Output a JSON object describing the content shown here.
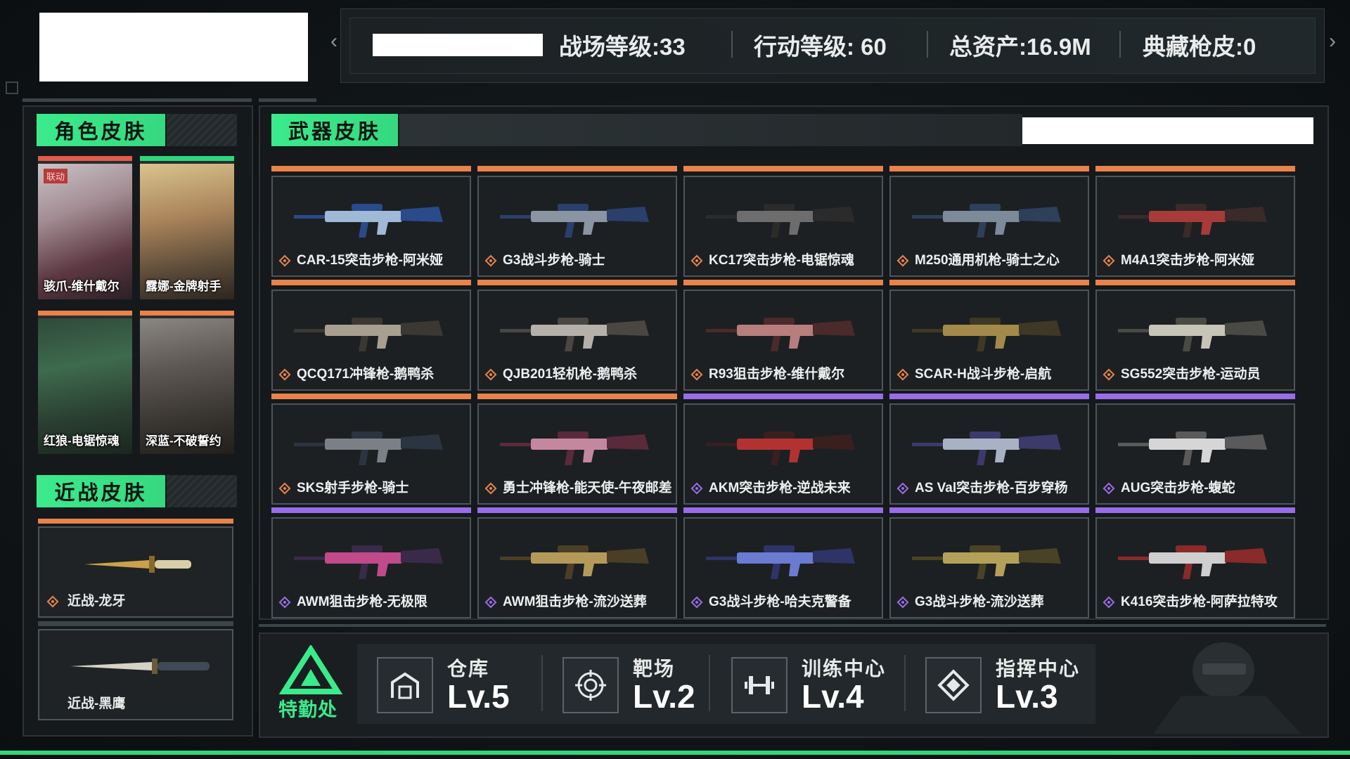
{
  "header": {
    "stats": [
      {
        "label": "战场等级:33"
      },
      {
        "label": "行动等级: 60"
      },
      {
        "label": "总资产:16.9M"
      },
      {
        "label": "典藏枪皮:0"
      }
    ],
    "nav_left": "‹",
    "nav_right": "›"
  },
  "character_skins": {
    "title": "角色皮肤",
    "items": [
      {
        "label": "骇爪-维什戴尔",
        "tag": "联动",
        "bar_color": "#e15c4a"
      },
      {
        "label": "露娜-金牌射手",
        "bar_color": "#2ed67c"
      },
      {
        "label": "红狼-电锯惊魂",
        "bar_color": "#e9834a"
      },
      {
        "label": "深蓝-不破誓约",
        "bar_color": "#e9834a"
      }
    ]
  },
  "melee_skins": {
    "title": "近战皮肤",
    "items": [
      {
        "label": "近战-龙牙",
        "bar_color": "#e9834a"
      },
      {
        "label": "近战-黑鹰",
        "bar_color": "#3b4548"
      }
    ]
  },
  "weapon_skins": {
    "title": "武器皮肤",
    "items": [
      {
        "label": "CAR-15突击步枪-阿米娅",
        "rarity": "orange"
      },
      {
        "label": "G3战斗步枪-骑士",
        "rarity": "orange"
      },
      {
        "label": "KC17突击步枪-电锯惊魂",
        "rarity": "orange"
      },
      {
        "label": "M250通用机枪-骑士之心",
        "rarity": "orange"
      },
      {
        "label": "M4A1突击步枪-阿米娅",
        "rarity": "orange"
      },
      {
        "label": "QCQ171冲锋枪-鹅鸭杀",
        "rarity": "orange"
      },
      {
        "label": "QJB201轻机枪-鹅鸭杀",
        "rarity": "orange"
      },
      {
        "label": "R93狙击步枪-维什戴尔",
        "rarity": "orange"
      },
      {
        "label": "SCAR-H战斗步枪-启航",
        "rarity": "orange"
      },
      {
        "label": "SG552突击步枪-运动员",
        "rarity": "orange"
      },
      {
        "label": "SKS射手步枪-骑士",
        "rarity": "orange"
      },
      {
        "label": "勇士冲锋枪-能天使-午夜邮差",
        "rarity": "orange"
      },
      {
        "label": "AKM突击步枪-逆战未来",
        "rarity": "purple"
      },
      {
        "label": "AS Val突击步枪-百步穿杨",
        "rarity": "purple"
      },
      {
        "label": "AUG突击步枪-蝮蛇",
        "rarity": "purple"
      },
      {
        "label": "AWM狙击步枪-无极限",
        "rarity": "purple"
      },
      {
        "label": "AWM狙击步枪-流沙送葬",
        "rarity": "purple"
      },
      {
        "label": "G3战斗步枪-哈夫克警备",
        "rarity": "purple"
      },
      {
        "label": "G3战斗步枪-流沙送葬",
        "rarity": "purple"
      },
      {
        "label": "K416突击步枪-阿萨拉特攻",
        "rarity": "purple"
      }
    ]
  },
  "facilities": {
    "brand": "特勤处",
    "items": [
      {
        "name": "仓库",
        "level": "Lv.5",
        "icon": "warehouse-icon"
      },
      {
        "name": "靶场",
        "level": "Lv.2",
        "icon": "target-icon"
      },
      {
        "name": "训练中心",
        "level": "Lv.4",
        "icon": "dumbbell-icon"
      },
      {
        "name": "指挥中心",
        "level": "Lv.3",
        "icon": "command-icon"
      }
    ]
  },
  "colors": {
    "accent_green": "#3aeb8c",
    "rarity_orange": "#e9834a",
    "rarity_purple": "#9a6ce8",
    "panel_bg": "#15191b"
  }
}
